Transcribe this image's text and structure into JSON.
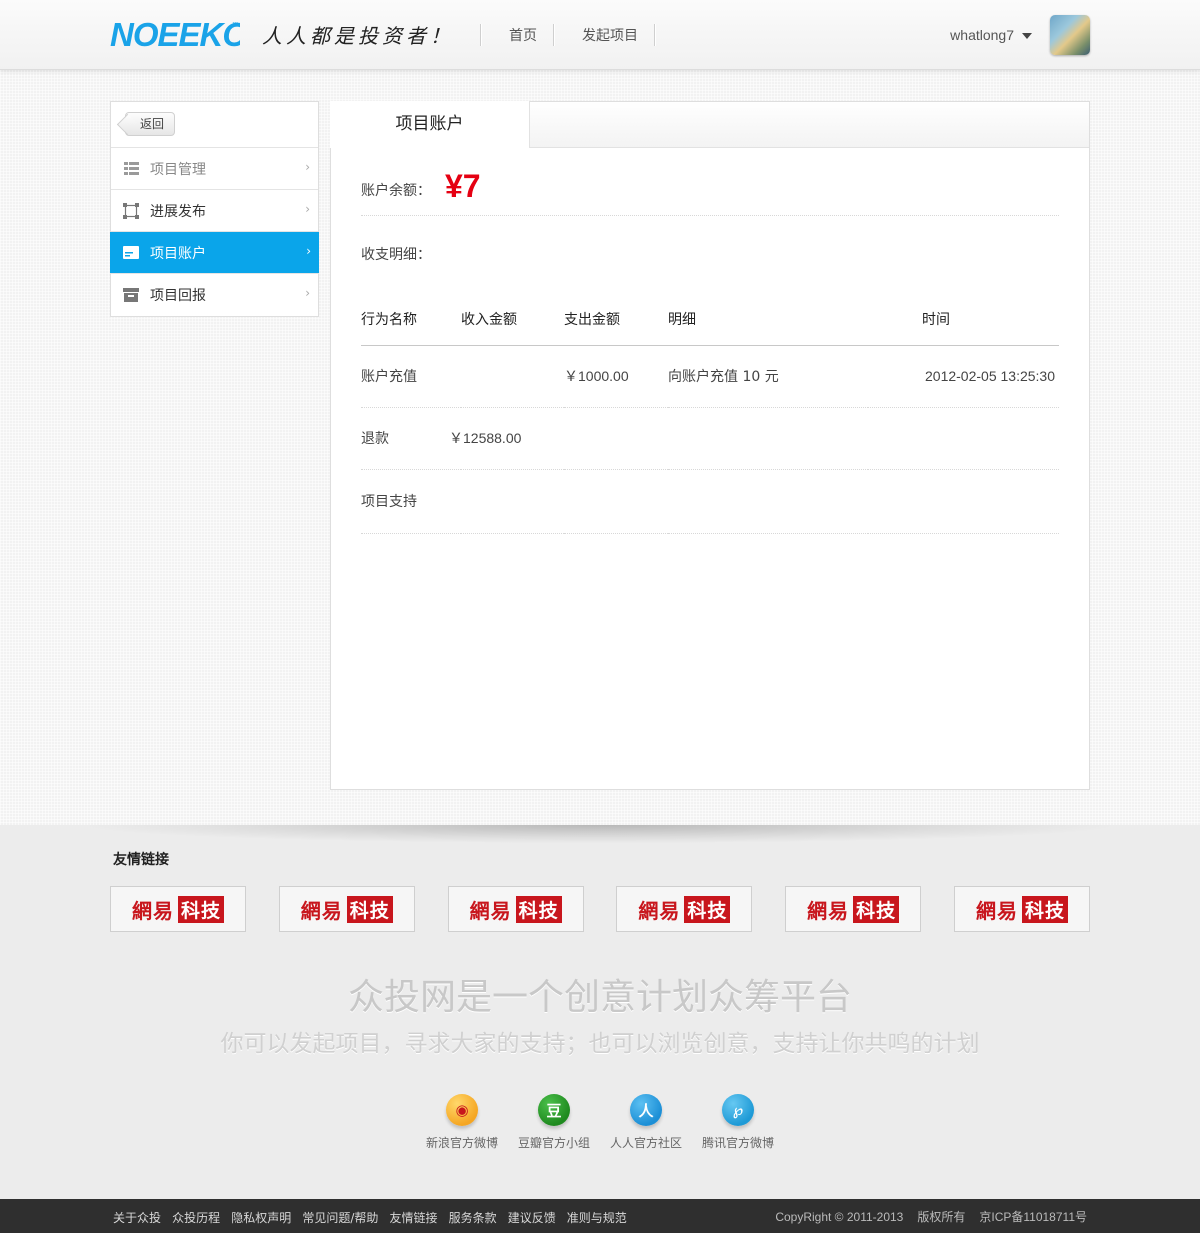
{
  "header": {
    "logo_text": "NOEEKO",
    "slogan": "人人都是投资者！",
    "nav": [
      "首页",
      "发起项目"
    ],
    "username": "whatlong7"
  },
  "sidebar": {
    "back_label": "返回",
    "items": [
      {
        "label": "项目管理",
        "icon": "grid-icon",
        "active": false
      },
      {
        "label": "进展发布",
        "icon": "frame-icon",
        "active": false
      },
      {
        "label": "项目账户",
        "icon": "wallet-icon",
        "active": true
      },
      {
        "label": "项目回报",
        "icon": "box-icon",
        "active": false
      }
    ]
  },
  "panel": {
    "tab_label": "项目账户",
    "balance_label": "账户余额：",
    "balance_value": "¥7",
    "detail_label": "收支明细：",
    "table": {
      "headers": [
        "行为名称",
        "收入金额",
        "支出金额",
        "明细",
        "时间"
      ],
      "rows": [
        [
          "账户充值",
          "",
          "￥1000.00",
          "向账户充值 10 元",
          "2012-02-05 13:25:30"
        ],
        [
          "退款",
          "￥12588.00",
          "",
          "",
          ""
        ],
        [
          "项目支持",
          "",
          "",
          "",
          ""
        ]
      ]
    }
  },
  "footer": {
    "links_title": "友情链接",
    "partners": [
      {
        "a": "網易",
        "b": "科技"
      },
      {
        "a": "網易",
        "b": "科技"
      },
      {
        "a": "網易",
        "b": "科技"
      },
      {
        "a": "網易",
        "b": "科技"
      },
      {
        "a": "網易",
        "b": "科技"
      },
      {
        "a": "網易",
        "b": "科技"
      }
    ],
    "headline": "众投网是一个创意计划众筹平台",
    "subline": "你可以发起项目，寻求大家的支持；也可以浏览创意，支持让你共鸣的计划",
    "socials": [
      {
        "label": "新浪官方微博",
        "glyph": "◉",
        "color": "#f5a623",
        "icon": "weibo-icon"
      },
      {
        "label": "豆瓣官方小组",
        "glyph": "豆",
        "color": "#1f8a1f",
        "icon": "douban-icon"
      },
      {
        "label": "人人官方社区",
        "glyph": "人",
        "color": "#1c8fd6",
        "icon": "renren-icon"
      },
      {
        "label": "腾讯官方微博",
        "glyph": "℘",
        "color": "#1e9ad6",
        "icon": "tencent-weibo-icon"
      }
    ],
    "bottom_links": [
      "关于众投",
      "众投历程",
      "隐私权声明",
      "常见问题/帮助",
      "友情链接",
      "服务条款",
      "建议反馈",
      "准则与规范"
    ],
    "copyright": "CopyRight © 2011-2013",
    "rights": "版权所有",
    "icp": "京ICP备11018711号"
  },
  "colors": {
    "accent": "#0aa5ea",
    "balance": "#e50012",
    "logo": "#1aa3e8"
  }
}
